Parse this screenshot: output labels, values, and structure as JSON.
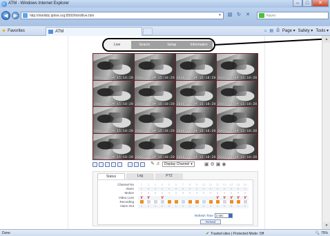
{
  "window": {
    "title": "ATM - Windows Internet Explorer",
    "minimize": "–",
    "maximize": "□",
    "close": "✕"
  },
  "address": {
    "url": "http://intellidz.iptme.org:8500/html/live.htm",
    "search_placeholder": "Naver"
  },
  "favorites": {
    "label": "Favorites",
    "tab_title": "ATM",
    "commands": [
      "Page ▾",
      "Safety ▾",
      "Tools ▾"
    ]
  },
  "menu": {
    "items": [
      "Live",
      "Search",
      "Setup",
      "Information"
    ],
    "active_index": 0
  },
  "video": {
    "timestamp": "2009/09/04 15:18:20",
    "cells": 16
  },
  "toolbar": {
    "display_label": "Display Channel"
  },
  "status_panel": {
    "tabs": [
      "Status",
      "Log",
      "PTZ"
    ],
    "active_tab": 0,
    "row_labels": [
      "Channel No",
      "Alarm",
      "Motion",
      "Video Loss",
      "Recording",
      "Alarm Out"
    ],
    "channels": [
      "1",
      "2",
      "3",
      "4",
      "5",
      "6",
      "7",
      "8",
      "9",
      "10",
      "11",
      "12",
      "13",
      "14",
      "15",
      "16"
    ],
    "video_loss": [
      1,
      1,
      0,
      1,
      0,
      0,
      0,
      0,
      0,
      0,
      0,
      1,
      1,
      1,
      1,
      1
    ],
    "recording": [
      1,
      0,
      0,
      0,
      1,
      1,
      0,
      1,
      1,
      0,
      1,
      1,
      0,
      1,
      1,
      0
    ],
    "refresh_label": "Refresh Time",
    "refresh_value": "1 sec",
    "reload_label": "Reload"
  },
  "statusbar": {
    "left": "Done",
    "zone": "Trusted sites | Protected Mode: Off",
    "zoom": "75%"
  },
  "colors": {
    "grid_border": "#6e1e28",
    "recording_on": "#f08e1e",
    "video_loss": "#cf2020"
  }
}
